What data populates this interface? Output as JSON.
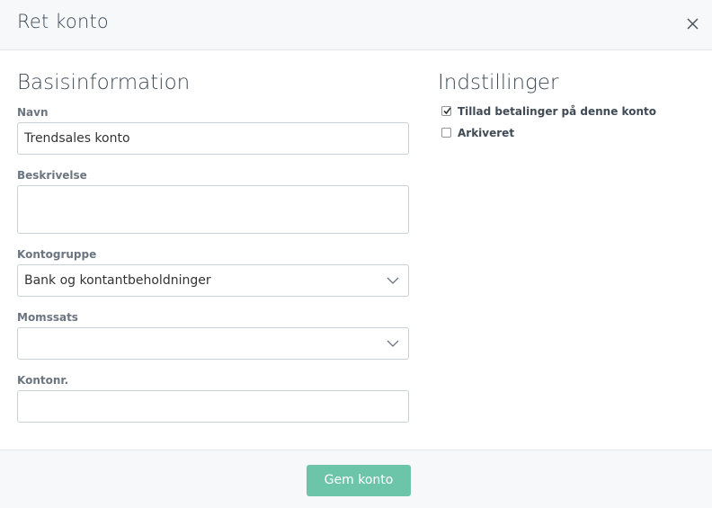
{
  "dialog": {
    "title": "Ret konto",
    "close_icon": "close-icon"
  },
  "basis": {
    "title": "Basisinformation",
    "name_label": "Navn",
    "name_value": "Trendsales konto",
    "description_label": "Beskrivelse",
    "description_value": "",
    "group_label": "Kontogruppe",
    "group_value": "Bank og kontantbeholdninger",
    "vat_label": "Momssats",
    "vat_value": "",
    "account_no_label": "Kontonr.",
    "account_no_value": ""
  },
  "settings": {
    "title": "Indstillinger",
    "allow_payments_label": "Tillad betalinger på denne konto",
    "allow_payments_checked": true,
    "archived_label": "Arkiveret",
    "archived_checked": false
  },
  "footer": {
    "save_label": "Gem konto"
  },
  "colors": {
    "accent": "#6cc5a8",
    "header_bg": "#f6f8fa",
    "border": "#c9d0d6"
  }
}
